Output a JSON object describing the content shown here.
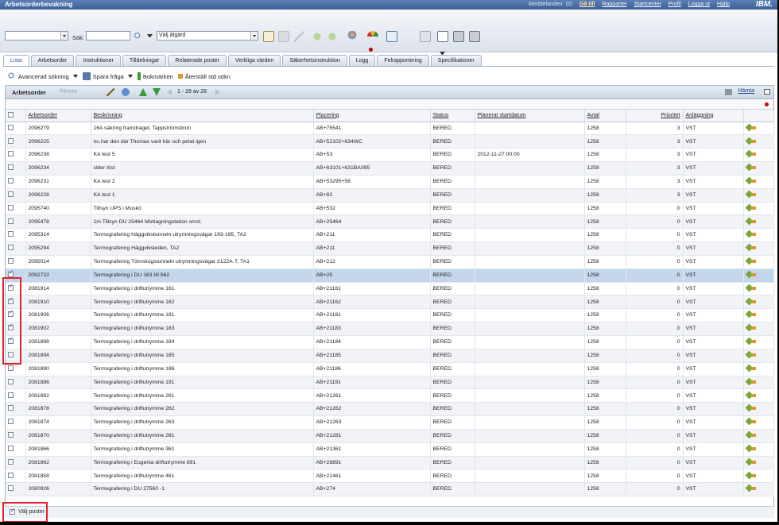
{
  "header": {
    "app_title": "Arbetsorderbevakning",
    "messages": "Meddelanden: (0)",
    "goto": "Gå till",
    "menu": [
      "Rapporter",
      "Startcenter",
      "Profil",
      "Logga ut",
      "Hjälp"
    ],
    "logo": "IBM."
  },
  "toolbar": {
    "search_label": "Sök:",
    "action_select": "Välj åtgärd"
  },
  "tabs": [
    "Lista",
    "Arbetsorder",
    "Instruktioner",
    "Tilldelningar",
    "Relaterade poster",
    "Verkliga värden",
    "Säkerhetsinstruktion",
    "Logg",
    "Felrapportering",
    "Specifikationer"
  ],
  "actions": {
    "advanced_search": "Avancerad sökning",
    "save_query": "Spara fråga",
    "bookmarks": "Bokmärken",
    "reset_search": "Återställ std sökn"
  },
  "panel": {
    "title": "Arbetsorder",
    "filter": "Filtrera",
    "pager": "1 - 28 av 28",
    "fetch": "Hämta"
  },
  "columns": {
    "wo": "Arbetsorder",
    "desc": "Beskrivning",
    "loc": "Placering",
    "status": "Status",
    "start": "Planerat startdatum",
    "contract": "Avtal",
    "prio": "Prioritet",
    "site": "Anläggning"
  },
  "rows": [
    {
      "checked": false,
      "wo": "2096279",
      "desc": "16A säkring framdraget, Tappströmsbron",
      "loc": "AB+75541",
      "status": "BERED",
      "start": "",
      "contract": "1258",
      "prio": "3",
      "site": "VST"
    },
    {
      "checked": false,
      "wo": "2096225",
      "desc": "nu har den där Thomas varit här och petat igen",
      "loc": "AB+52102+634WC",
      "status": "BERED",
      "start": "",
      "contract": "1258",
      "prio": "3",
      "site": "VST"
    },
    {
      "checked": false,
      "wo": "2096238",
      "desc": "KA test 5",
      "loc": "AB+53",
      "status": "BERED",
      "start": "2012-11-27 00:00",
      "contract": "1258",
      "prio": "3",
      "site": "VST"
    },
    {
      "checked": false,
      "wo": "2096234",
      "desc": "sitter löst",
      "loc": "AB+63101+631BA095",
      "status": "BERED",
      "start": "",
      "contract": "1258",
      "prio": "3",
      "site": "VST"
    },
    {
      "checked": false,
      "wo": "2096231",
      "desc": "KA test 2",
      "loc": "AB+53295+58",
      "status": "BERED",
      "start": "",
      "contract": "1258",
      "prio": "3",
      "site": "VST"
    },
    {
      "checked": false,
      "wo": "2096228",
      "desc": "KA test 1",
      "loc": "AB+82",
      "status": "BERED",
      "start": "",
      "contract": "1258",
      "prio": "3",
      "site": "VST"
    },
    {
      "checked": false,
      "wo": "2095740",
      "desc": "Tillsyn UPS i Muskö",
      "loc": "AB+532",
      "status": "BERED",
      "start": "",
      "contract": "1258",
      "prio": "0",
      "site": "VST"
    },
    {
      "checked": false,
      "wo": "2095478",
      "desc": "1m Tillsyn DU 25464 Mottagningstation smst.",
      "loc": "AB+25464",
      "status": "BERED",
      "start": "",
      "contract": "1258",
      "prio": "0",
      "site": "VST"
    },
    {
      "checked": false,
      "wo": "2095314",
      "desc": "Termografering Häggvikstunneln utrymningsvägar 193-195, TA2",
      "loc": "AB+211",
      "status": "BERED",
      "start": "",
      "contract": "1258",
      "prio": "0",
      "site": "VST"
    },
    {
      "checked": false,
      "wo": "2095294",
      "desc": "Termografering Häggviksleden, TA2",
      "loc": "AB+211",
      "status": "BERED",
      "start": "",
      "contract": "1258",
      "prio": "0",
      "site": "VST"
    },
    {
      "checked": false,
      "wo": "2095014",
      "desc": "Termografering Törnskogstunneln utrymningsvägar 2122A-T, TA1",
      "loc": "AB+212",
      "status": "BERED",
      "start": "",
      "contract": "1258",
      "prio": "0",
      "site": "VST"
    },
    {
      "checked": true,
      "selected": true,
      "wo": "2092722",
      "desc": "Termografering i DU 163 till 562",
      "loc": "AB+25",
      "status": "BERED",
      "start": "",
      "contract": "1258",
      "prio": "0",
      "site": "VST"
    },
    {
      "checked": true,
      "wo": "2081914",
      "desc": "Termografering i driftutrymme 161",
      "loc": "AB+21161",
      "status": "BERED",
      "start": "",
      "contract": "1258",
      "prio": "0",
      "site": "VST"
    },
    {
      "checked": true,
      "wo": "2081910",
      "desc": "Termografering i driftutrymme 162",
      "loc": "AB+21162",
      "status": "BERED",
      "start": "",
      "contract": "1258",
      "prio": "0",
      "site": "VST"
    },
    {
      "checked": true,
      "wo": "2081906",
      "desc": "Termografering i driftutrymme 181",
      "loc": "AB+21181",
      "status": "BERED",
      "start": "",
      "contract": "1258",
      "prio": "0",
      "site": "VST"
    },
    {
      "checked": true,
      "wo": "2081902",
      "desc": "Termografering i driftutrymme 183",
      "loc": "AB+21183",
      "status": "BERED",
      "start": "",
      "contract": "1258",
      "prio": "0",
      "site": "VST"
    },
    {
      "checked": true,
      "wo": "2081898",
      "desc": "Termografering i driftutrymme 184",
      "loc": "AB+21184",
      "status": "BERED",
      "start": "",
      "contract": "1258",
      "prio": "0",
      "site": "VST"
    },
    {
      "checked": false,
      "wo": "2081894",
      "desc": "Termografering i driftutrymme 185",
      "loc": "AB+21185",
      "status": "BERED",
      "start": "",
      "contract": "1258",
      "prio": "0",
      "site": "VST"
    },
    {
      "checked": false,
      "wo": "2081890",
      "desc": "Termografering i driftutrymme 186",
      "loc": "AB+21186",
      "status": "BERED",
      "start": "",
      "contract": "1258",
      "prio": "0",
      "site": "VST"
    },
    {
      "checked": false,
      "wo": "2081886",
      "desc": "Termografering i driftutrymme 191",
      "loc": "AB+21191",
      "status": "BERED",
      "start": "",
      "contract": "1258",
      "prio": "0",
      "site": "VST"
    },
    {
      "checked": false,
      "wo": "2081882",
      "desc": "Termografering i driftutrymme 261",
      "loc": "AB+21261",
      "status": "BERED",
      "start": "",
      "contract": "1258",
      "prio": "0",
      "site": "VST"
    },
    {
      "checked": false,
      "wo": "2081878",
      "desc": "Termografering i driftutrymme 262",
      "loc": "AB+21262",
      "status": "BERED",
      "start": "",
      "contract": "1258",
      "prio": "0",
      "site": "VST"
    },
    {
      "checked": false,
      "wo": "2081874",
      "desc": "Termografering i driftutrymme 263",
      "loc": "AB+21263",
      "status": "BERED",
      "start": "",
      "contract": "1258",
      "prio": "0",
      "site": "VST"
    },
    {
      "checked": false,
      "wo": "2081870",
      "desc": "Termografering i driftutrymme 281",
      "loc": "AB+21281",
      "status": "BERED",
      "start": "",
      "contract": "1258",
      "prio": "0",
      "site": "VST"
    },
    {
      "checked": false,
      "wo": "2081866",
      "desc": "Termografering i driftutrymme 361",
      "loc": "AB+21361",
      "status": "BERED",
      "start": "",
      "contract": "1258",
      "prio": "0",
      "site": "VST"
    },
    {
      "checked": false,
      "wo": "2081862",
      "desc": "Termografering i Eugenia driftutrymme 891",
      "loc": "AB+28891",
      "status": "BERED",
      "start": "",
      "contract": "1258",
      "prio": "0",
      "site": "VST"
    },
    {
      "checked": false,
      "wo": "2081858",
      "desc": "Termografering i driftutrymme 461",
      "loc": "AB+21461",
      "status": "BERED",
      "start": "",
      "contract": "1258",
      "prio": "0",
      "site": "VST"
    },
    {
      "checked": false,
      "wo": "2080926",
      "desc": "Termografering i DU 27560 -1",
      "loc": "AB+274",
      "status": "BERED",
      "start": "",
      "contract": "1258",
      "prio": "0",
      "site": "VST"
    }
  ],
  "footer": {
    "select_records": "Välj poster"
  },
  "colors": {
    "accent": "#3d5f98",
    "highlight": "#e0222a",
    "selected_row": "#c4d6ec"
  }
}
